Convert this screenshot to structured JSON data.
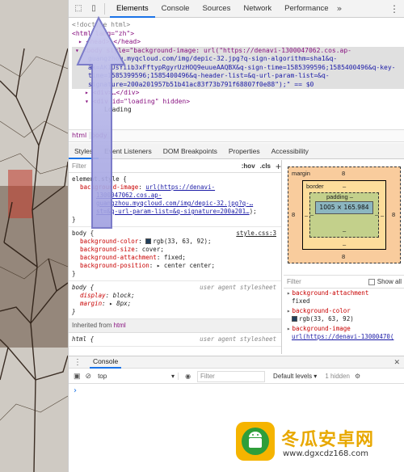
{
  "toolbar": {
    "tabs": [
      "Elements",
      "Console",
      "Sources",
      "Network",
      "Performance"
    ],
    "more_label": "»",
    "menu_label": "⋮"
  },
  "code": {
    "lines": [
      "<!doctype html>",
      "<html lang=\"zh\">",
      "▸ <head>…</head>",
      "▾ <body style=\"background-image: url(\"https://denavi-1300047062.cos.ap-",
      "guangzhou.myqcloud.com/img/depic-32.jpg?q-sign-algorithm=sha1&q-",
      "ak=AKIDsYiib3xFftypRgyrUzHOQ9euueAAQBX&q-sign-time=1585399596;1585400496&q-key-",
      "time=1585399596;1585400496&q-header-list=&q-url-param-list=&q-",
      "signature=200a201957b51b41ac83f73b791f68807f0e88\");\" == $0",
      "▸ <div>…</div>",
      "▾ <div id=\"loading\" hidden>",
      "Loading"
    ]
  },
  "breadcrumb": {
    "left": "html",
    "active": "body"
  },
  "subtabs": [
    "Styles",
    "Event Listeners",
    "DOM Breakpoints",
    "Properties",
    "Accessibility"
  ],
  "styles": {
    "filter_placeholder": "Filter",
    "hov": ":hov",
    "cls": ".cls",
    "plus": "+",
    "element_style": {
      "selector": "element.style {",
      "prop": "background-image",
      "url_lines": [
        "url(https://denavi-",
        "1300047062.cos.ap-",
        "guangzhou.myqcloud.com/img/depic-32.jpg?q-…",
        "st=&q-url-param-list=&q-signature=200a201…"
      ],
      "url_end": ");",
      "close": "}"
    },
    "body_rule": {
      "selector": "body {",
      "source": "style.css:3",
      "props": [
        {
          "name": "background-color",
          "value": "rgb(33, 63, 92)",
          "swatch": "#213f5c"
        },
        {
          "name": "background-size",
          "value": "cover;"
        },
        {
          "name": "background-attachment",
          "value": "fixed;"
        },
        {
          "name": "background-position",
          "value": "▸ center center;"
        }
      ],
      "close": "}"
    },
    "ua_rule": {
      "selector": "body {",
      "source": "user agent stylesheet",
      "props": [
        {
          "name": "display",
          "value": "block;"
        },
        {
          "name": "margin",
          "value": "▸ 8px;"
        }
      ],
      "close": "}"
    },
    "inherited_label": "Inherited from",
    "inherited_from": "html",
    "html_rule": {
      "selector": "html {",
      "source": "user agent stylesheet"
    }
  },
  "boxmodel": {
    "margin_label": "margin",
    "margin_value": "8",
    "border_label": "border",
    "border_value": "–",
    "padding_label": "padding –",
    "content": "1005 × 165.984",
    "dash": "–",
    "side_value": "8"
  },
  "computed": {
    "filter_placeholder": "Filter",
    "show_all": "Show all",
    "items": [
      {
        "name": "background-attachment",
        "value": "fixed"
      },
      {
        "name": "background-color",
        "value": "rgb(33, 63, 92)",
        "swatch": "#213f5c"
      },
      {
        "name": "background-image",
        "value": "url(https://denavi-13000470("
      }
    ]
  },
  "drawer": {
    "tab": "Console",
    "close": "✕",
    "context": "top",
    "filter_placeholder": "Filter",
    "levels": "Default levels ▾",
    "hidden": "1 hidden",
    "prompt": "›"
  },
  "watermark": {
    "title": "冬瓜安卓网",
    "url": "www.dgxcdz168.com"
  }
}
